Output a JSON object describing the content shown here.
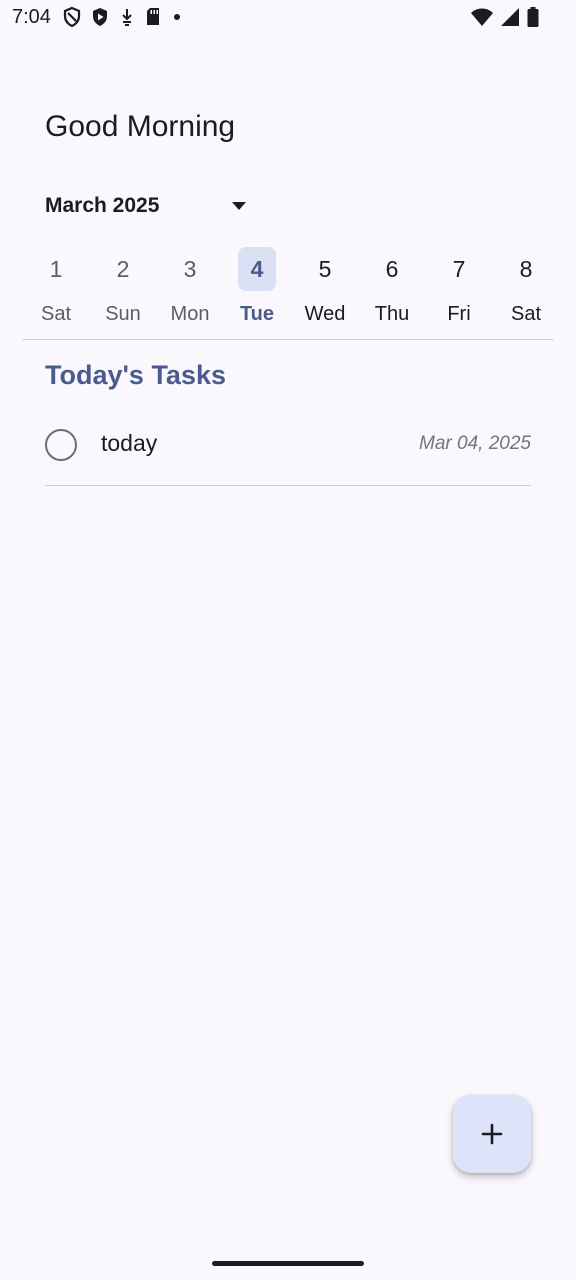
{
  "status_bar": {
    "time": "7:04",
    "left_icons": [
      "shield-outline-icon",
      "shield-play-icon",
      "download-icon",
      "sd-card-icon",
      "notification-dot-icon"
    ],
    "right_icons": [
      "wifi-icon",
      "signal-icon",
      "battery-icon"
    ]
  },
  "header": {
    "greeting": "Good Morning"
  },
  "calendar": {
    "month_label": "March 2025",
    "days": [
      {
        "num": "1",
        "name": "Sat"
      },
      {
        "num": "2",
        "name": "Sun"
      },
      {
        "num": "3",
        "name": "Mon"
      },
      {
        "num": "4",
        "name": "Tue"
      },
      {
        "num": "5",
        "name": "Wed"
      },
      {
        "num": "6",
        "name": "Thu"
      },
      {
        "num": "7",
        "name": "Fri"
      },
      {
        "num": "8",
        "name": "Sat"
      }
    ],
    "selected_day": "4"
  },
  "tasks": {
    "section_title": "Today's Tasks",
    "items": [
      {
        "title": "today",
        "date": "Mar 04, 2025",
        "completed": false
      }
    ]
  },
  "fab": {
    "icon": "plus-icon"
  },
  "colors": {
    "background": "#faf7fd",
    "accent": "#4a5b8f",
    "selected_day_bg": "#dbe0f5",
    "fab_bg": "#dde3f8"
  }
}
